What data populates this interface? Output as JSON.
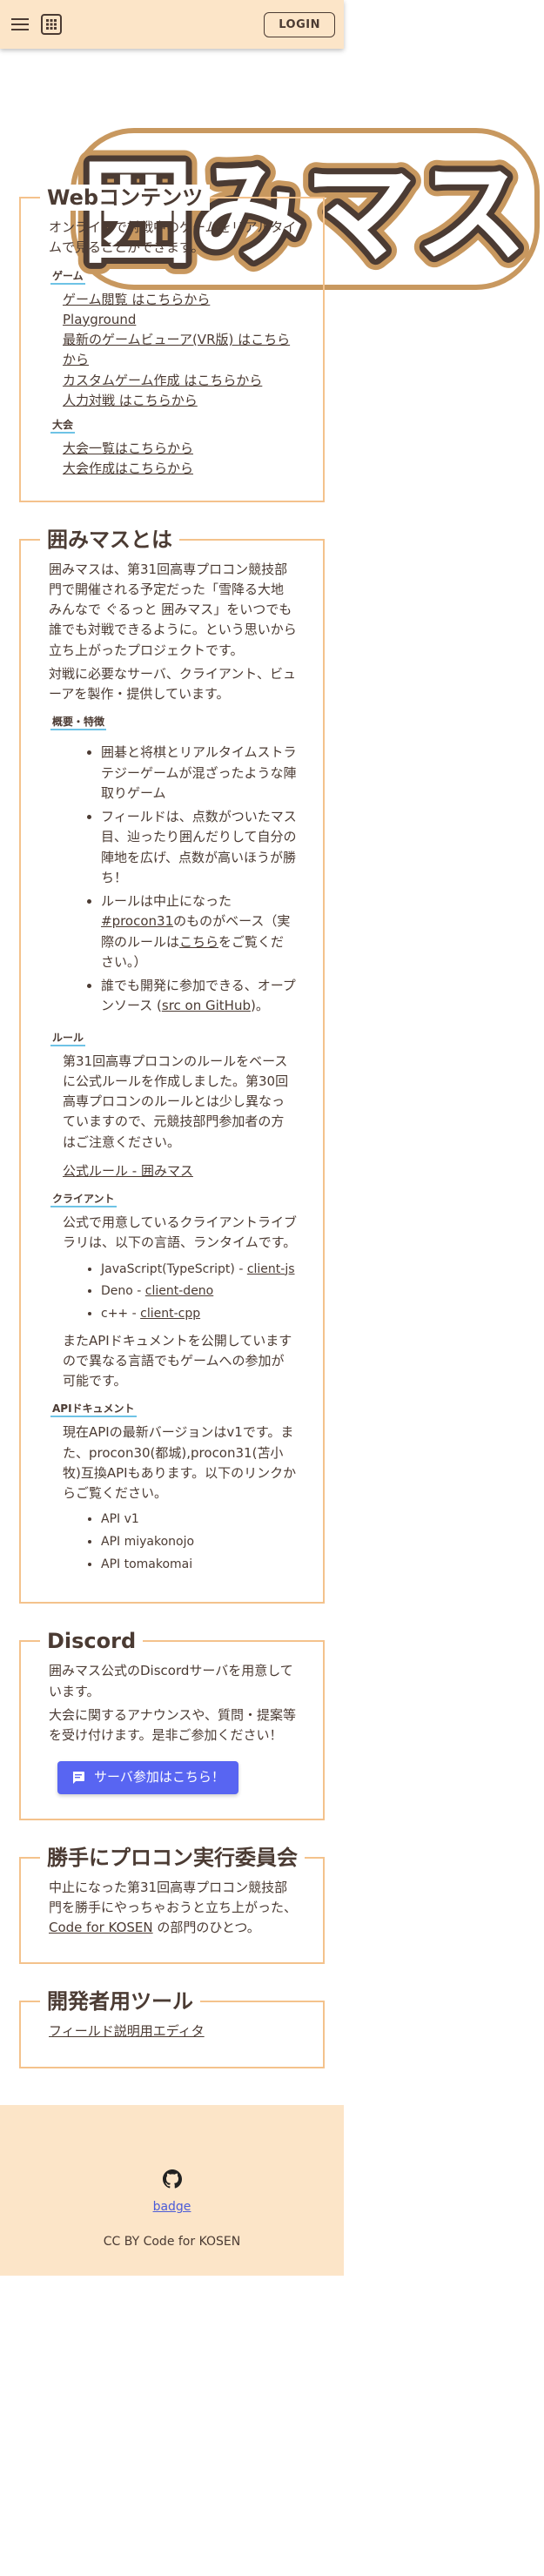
{
  "header": {
    "login_label": "LOGIN",
    "menu_icon": "hamburger-menu-icon",
    "apps_icon": "apps-grid-icon"
  },
  "logo": {
    "text": "囲みマス"
  },
  "web": {
    "title": "Webコンテンツ",
    "intro": "オンラインで対戦中のゲームをリアルタイムで見ることができます。",
    "game_label": "ゲーム",
    "game_links": [
      "ゲーム閲覧 はこちらから",
      "Playground",
      "最新のゲームビューア(VR版) はこちらから",
      "カスタムゲーム作成 はこちらから",
      "人力対戦 はこちらから"
    ],
    "tournament_label": "大会",
    "tournament_links": [
      "大会一覧はこちらから",
      "大会作成はこちらから"
    ]
  },
  "about": {
    "title": "囲みマスとは",
    "intro1": "囲みマスは、第31回高専プロコン競技部門で開催される予定だった「雪降る大地 みんなで ぐるっと 囲みマス」をいつでも誰でも対戦できるように。という思いから立ち上がったプロジェクトです。",
    "intro2": "対戦に必要なサーバ、クライアント、ビューアを製作・提供しています。",
    "features_label": "概要・特徴",
    "features": [
      "囲碁と将棋とリアルタイムストラテジーゲームが混ざったような陣取りゲーム",
      "フィールドは、点数がついたマス目、辿ったり囲んだりして自分の陣地を広げ、点数が高いほうが勝ち！"
    ],
    "feature3_a": "ルールは中止になった",
    "feature3_link1": "#procon31",
    "feature3_b": "のものがベース（実際のルールは",
    "feature3_link2": "こちら",
    "feature3_c": "をご覧ください。）",
    "feature4_a": "誰でも開発に参加できる、オープンソース (",
    "feature4_link": "src on GitHub",
    "feature4_b": ")。",
    "rules_label": "ルール",
    "rules_text": "第31回高専プロコンのルールをベースに公式ルールを作成しました。第30回高専プロコンのルールとは少し異なっていますので、元競技部門参加者の方はご注意ください。",
    "rules_link": "公式ルール - 囲みマス",
    "client_label": "クライアント",
    "client_text": "公式で用意しているクライアントライブラリは、以下の言語、ランタイムです。",
    "client_js_prefix": "JavaScript(TypeScript) - ",
    "client_js_link": "client-js",
    "client_deno_prefix": "Deno - ",
    "client_deno_link": "client-deno",
    "client_cpp_prefix": "c++ - ",
    "client_cpp_link": "client-cpp",
    "client_note": "またAPIドキュメントを公開していますので異なる言語でもゲームへの参加が可能です。",
    "api_label": "APIドキュメント",
    "api_text": "現在APIの最新バージョンはv1です。また、procon30(都城),procon31(苫小牧)互換APIもあります。以下のリンクからご覧ください。",
    "api_links": [
      "API v1",
      "API miyakonojo",
      "API tomakomai"
    ]
  },
  "discord": {
    "title": "Discord",
    "text1": "囲みマス公式のDiscordサーバを用意しています。",
    "text2": "大会に関するアナウンスや、質問・提案等を受け付けます。是非ご参加ください！",
    "button_label": "サーバ参加はこちら！"
  },
  "committee": {
    "title": "勝手にプロコン実行委員会",
    "text_a": "中止になった第31回高専プロコン競技部門を勝手にやっちゃおうと立ち上がった、",
    "link": "Code for KOSEN",
    "text_b": " の部門のひとつ。"
  },
  "devtools": {
    "title": "開発者用ツール",
    "link": "フィールド説明用エディタ"
  },
  "footer": {
    "github_icon": "github-icon",
    "badge_text": "badge",
    "copyright": "CC BY Code for KOSEN"
  },
  "colors": {
    "header_bg": "#fce5c8",
    "border": "#f4c28c",
    "accent_underline": "#6ec3e6",
    "discord": "#5865f2",
    "text": "#4b3b33"
  }
}
